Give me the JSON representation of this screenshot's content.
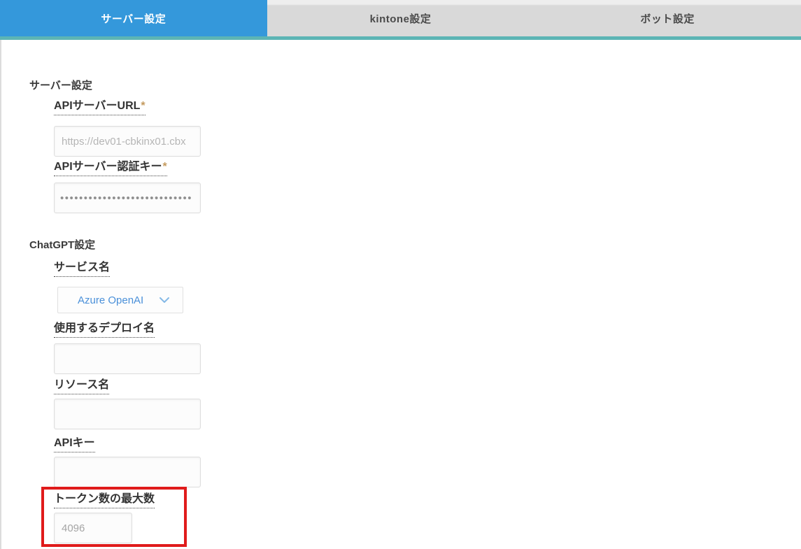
{
  "tabs": [
    {
      "label": "サーバー設定",
      "active": true
    },
    {
      "label": "kintone設定",
      "active": false
    },
    {
      "label": "ボット設定",
      "active": false
    }
  ],
  "sections": {
    "server": {
      "heading": "サーバー設定",
      "fields": {
        "api_server_url": {
          "label": "APIサーバーURL",
          "required_mark": "*",
          "placeholder": "https://dev01-cbkinx01.cbx",
          "value": ""
        },
        "api_server_auth_key": {
          "label": "APIサーバー認証キー",
          "required_mark": "*",
          "value": "••••••••••••••••••••••••••••"
        }
      }
    },
    "chatgpt": {
      "heading": "ChatGPT設定",
      "fields": {
        "service_name": {
          "label": "サービス名",
          "selected": "Azure OpenAI"
        },
        "deploy_name": {
          "label": "使用するデプロイ名",
          "value": ""
        },
        "resource_name": {
          "label": "リソース名",
          "value": ""
        },
        "api_key": {
          "label": "APIキー",
          "value": ""
        },
        "max_tokens": {
          "label": "トークン数の最大数",
          "value": "4096"
        }
      }
    }
  },
  "icons": {
    "chevron_down": "chevron-down-icon"
  },
  "colors": {
    "active_tab_blue": "#3498db",
    "inactive_tab_gray": "#d9d9d9",
    "tab_underline_teal": "#5cb5b5",
    "required_asterisk": "#c49a5e",
    "dropdown_text_blue": "#4a90d9",
    "highlight_red": "#e01b1b"
  }
}
